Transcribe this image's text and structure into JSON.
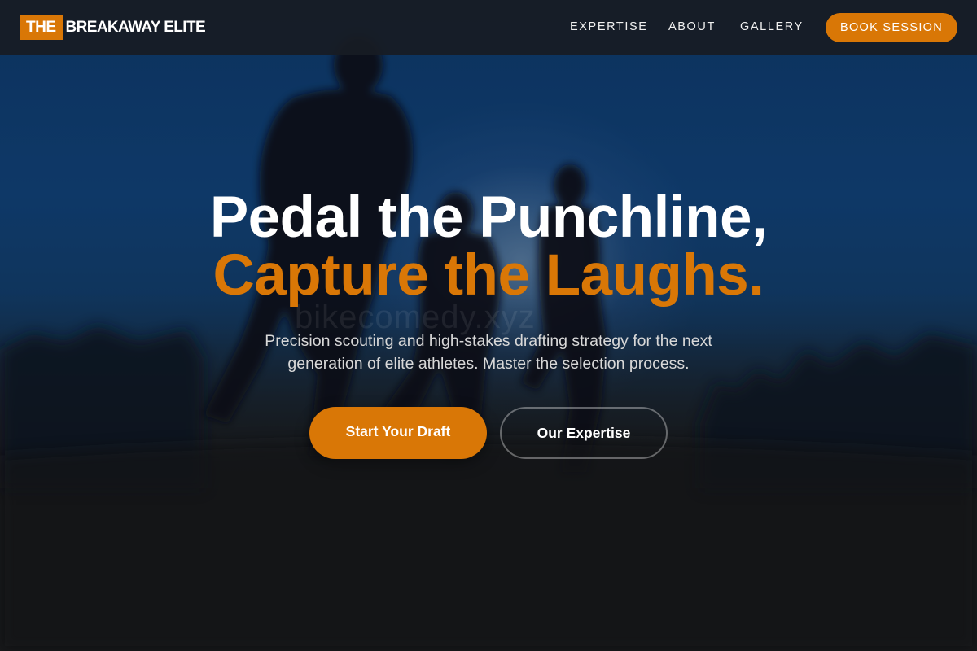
{
  "brand": {
    "logo_box_text": "THE",
    "logo_text": "BREAKAWAY ELITE",
    "accent_color": "#d97706"
  },
  "nav": {
    "links": [
      {
        "label": "EXPERTISE"
      },
      {
        "label": "ABOUT"
      },
      {
        "label": "GALLERY"
      }
    ],
    "cta_label": "BOOK SESSION"
  },
  "hero": {
    "headline_line1": "Pedal the Punchline,",
    "headline_line2": "Capture the Laughs.",
    "subtitle": "Precision scouting and high-stakes drafting strategy for the next generation of elite athletes. Master the selection process.",
    "primary_button": "Start Your Draft",
    "secondary_button": "Our Expertise",
    "watermark": "bikecomedy.xyz",
    "background_image": "silhouetted-runners-at-dusk"
  }
}
